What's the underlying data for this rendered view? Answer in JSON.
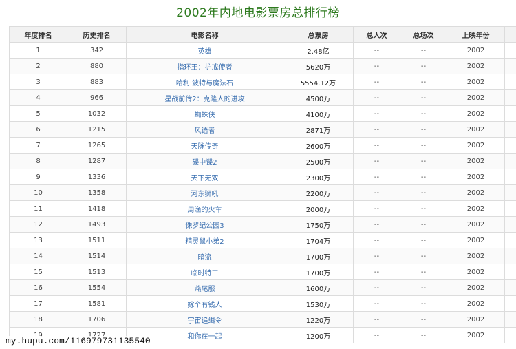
{
  "page": {
    "title": "2002年内地电影票房总排行榜",
    "watermark": "my.hupu.com/116979731135540"
  },
  "table": {
    "headers": [
      "年度排名",
      "历史排名",
      "电影名称",
      "总票房",
      "总人次",
      "总场次",
      "上映年份"
    ],
    "rows": [
      {
        "year_rank": "1",
        "hist_rank": "342",
        "title": "英雄",
        "box": "2.48亿",
        "people": "--",
        "shows": "--",
        "year": "2002"
      },
      {
        "year_rank": "2",
        "hist_rank": "880",
        "title": "指环王：护戒使者",
        "box": "5620万",
        "people": "--",
        "shows": "--",
        "year": "2002"
      },
      {
        "year_rank": "3",
        "hist_rank": "883",
        "title": "哈利·波特与魔法石",
        "box": "5554.12万",
        "people": "--",
        "shows": "--",
        "year": "2002"
      },
      {
        "year_rank": "4",
        "hist_rank": "966",
        "title": "星战前传2：克隆人的进攻",
        "box": "4500万",
        "people": "--",
        "shows": "--",
        "year": "2002"
      },
      {
        "year_rank": "5",
        "hist_rank": "1032",
        "title": "蜘蛛侠",
        "box": "4100万",
        "people": "--",
        "shows": "--",
        "year": "2002"
      },
      {
        "year_rank": "6",
        "hist_rank": "1215",
        "title": "风语者",
        "box": "2871万",
        "people": "--",
        "shows": "--",
        "year": "2002"
      },
      {
        "year_rank": "7",
        "hist_rank": "1265",
        "title": "天脉传奇",
        "box": "2600万",
        "people": "--",
        "shows": "--",
        "year": "2002"
      },
      {
        "year_rank": "8",
        "hist_rank": "1287",
        "title": "碟中谍2",
        "box": "2500万",
        "people": "--",
        "shows": "--",
        "year": "2002"
      },
      {
        "year_rank": "9",
        "hist_rank": "1336",
        "title": "天下无双",
        "box": "2300万",
        "people": "--",
        "shows": "--",
        "year": "2002"
      },
      {
        "year_rank": "10",
        "hist_rank": "1358",
        "title": "河东狮吼",
        "box": "2200万",
        "people": "--",
        "shows": "--",
        "year": "2002"
      },
      {
        "year_rank": "11",
        "hist_rank": "1418",
        "title": "周渔的火车",
        "box": "2000万",
        "people": "--",
        "shows": "--",
        "year": "2002"
      },
      {
        "year_rank": "12",
        "hist_rank": "1493",
        "title": "侏罗纪公园3",
        "box": "1750万",
        "people": "--",
        "shows": "--",
        "year": "2002"
      },
      {
        "year_rank": "13",
        "hist_rank": "1511",
        "title": "精灵鼠小弟2",
        "box": "1704万",
        "people": "--",
        "shows": "--",
        "year": "2002"
      },
      {
        "year_rank": "14",
        "hist_rank": "1514",
        "title": "暗流",
        "box": "1700万",
        "people": "--",
        "shows": "--",
        "year": "2002"
      },
      {
        "year_rank": "15",
        "hist_rank": "1513",
        "title": "临时特工",
        "box": "1700万",
        "people": "--",
        "shows": "--",
        "year": "2002"
      },
      {
        "year_rank": "16",
        "hist_rank": "1554",
        "title": "燕尾服",
        "box": "1600万",
        "people": "--",
        "shows": "--",
        "year": "2002"
      },
      {
        "year_rank": "17",
        "hist_rank": "1581",
        "title": "嫁个有钱人",
        "box": "1530万",
        "people": "--",
        "shows": "--",
        "year": "2002"
      },
      {
        "year_rank": "18",
        "hist_rank": "1706",
        "title": "宇宙追缉令",
        "box": "1220万",
        "people": "--",
        "shows": "--",
        "year": "2002"
      },
      {
        "year_rank": "19",
        "hist_rank": "1727",
        "title": "和你在一起",
        "box": "1200万",
        "people": "--",
        "shows": "--",
        "year": "2002"
      }
    ]
  },
  "colors": {
    "title": "#2d7a1e",
    "link": "#3a6fb0",
    "header_bg": "#f2f2f2",
    "border": "#dcdcdc"
  }
}
